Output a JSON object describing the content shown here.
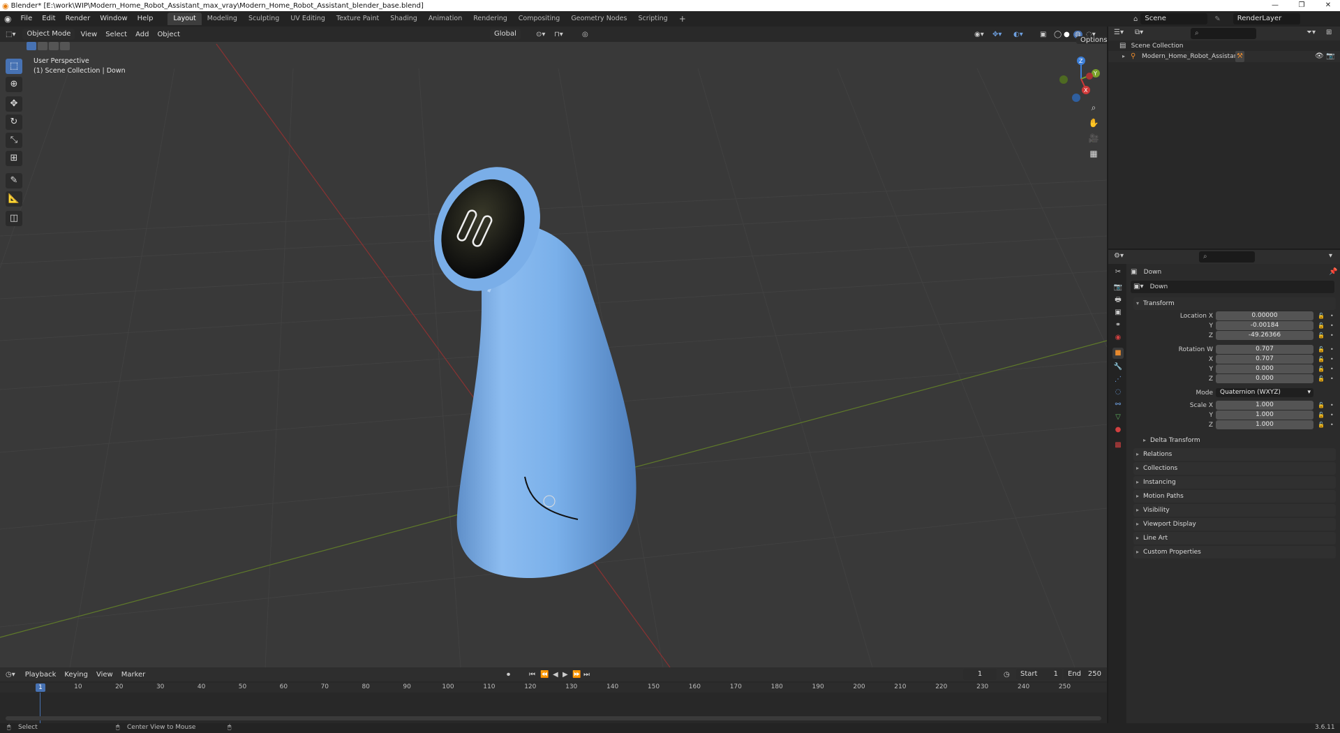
{
  "window": {
    "title": "Blender* [E:\\work\\WIP\\Modern_Home_Robot_Assistant_max_vray\\Modern_Home_Robot_Assistant_blender_base.blend]",
    "min": "—",
    "max": "❐",
    "close": "✕"
  },
  "menu": {
    "items": [
      "File",
      "Edit",
      "Render",
      "Window",
      "Help"
    ]
  },
  "workspaces": [
    "Layout",
    "Modeling",
    "Sculpting",
    "UV Editing",
    "Texture Paint",
    "Shading",
    "Animation",
    "Rendering",
    "Compositing",
    "Geometry Nodes",
    "Scripting"
  ],
  "workspace_add": "+",
  "scene": {
    "label": "Scene",
    "render_layer": "RenderLayer"
  },
  "viewport": {
    "mode": "Object Mode",
    "menus": [
      "View",
      "Select",
      "Add",
      "Object"
    ],
    "transform_orientation": "Global",
    "options": "Options",
    "info_line1": "User Perspective",
    "info_line2": "(1) Scene Collection | Down",
    "gizmo": {
      "z": "Z",
      "y": "Y",
      "x": "X"
    }
  },
  "outliner": {
    "collection": "Scene Collection",
    "object": "Modern_Home_Robot_Assistant"
  },
  "properties": {
    "object_name": "Down",
    "data_name": "Down",
    "transform_title": "Transform",
    "location": {
      "label_x": "Location X",
      "label_y": "Y",
      "label_z": "Z",
      "x": "0.00000",
      "y": "-0.00184",
      "z": "-49.26366"
    },
    "rotation": {
      "label_w": "Rotation W",
      "label_x": "X",
      "label_y": "Y",
      "label_z": "Z",
      "w": "0.707",
      "x": "0.707",
      "y": "0.000",
      "z": "0.000"
    },
    "mode": {
      "label": "Mode",
      "value": "Quaternion (WXYZ)"
    },
    "scale": {
      "label_x": "Scale X",
      "label_y": "Y",
      "label_z": "Z",
      "x": "1.000",
      "y": "1.000",
      "z": "1.000"
    },
    "delta": "Delta Transform",
    "panels": [
      "Relations",
      "Collections",
      "Instancing",
      "Motion Paths",
      "Visibility",
      "Viewport Display",
      "Line Art",
      "Custom Properties"
    ]
  },
  "timeline": {
    "menus": [
      "Playback",
      "Keying",
      "View",
      "Marker"
    ],
    "current_frame": "1",
    "start_label": "Start",
    "start": "1",
    "end_label": "End",
    "end": "250",
    "ruler": [
      "10",
      "20",
      "30",
      "40",
      "50",
      "60",
      "70",
      "80",
      "90",
      "100",
      "110",
      "120",
      "130",
      "140",
      "150",
      "160",
      "170",
      "180",
      "190",
      "200",
      "210",
      "220",
      "230",
      "240",
      "250"
    ],
    "playhead": "1"
  },
  "status": {
    "select": "Select",
    "center": "Center View to Mouse",
    "version": "3.6.11"
  }
}
